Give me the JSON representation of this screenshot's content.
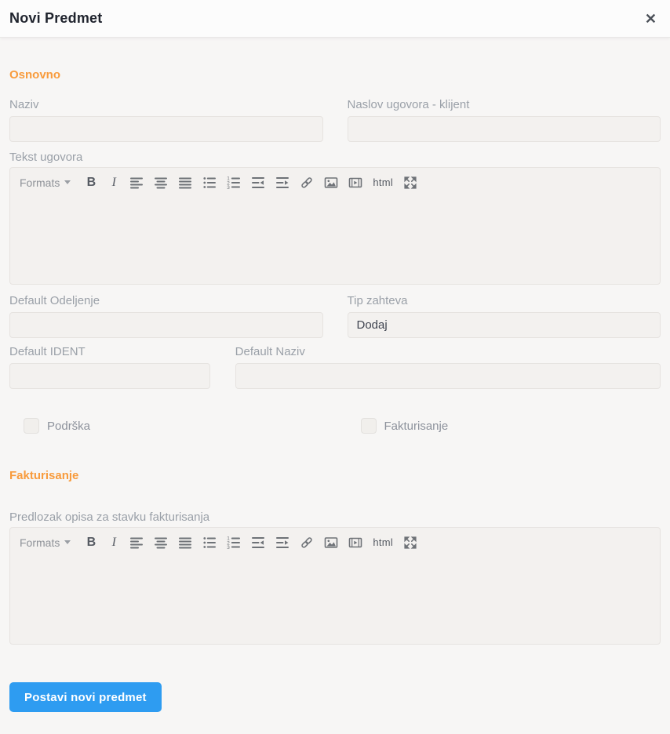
{
  "modal": {
    "title": "Novi Predmet",
    "close_glyph": "✕"
  },
  "sections": [
    {
      "heading": "Osnovno"
    },
    {
      "heading": "Fakturisanje"
    }
  ],
  "fields": {
    "naziv": {
      "label": "Naziv",
      "value": ""
    },
    "naslov_ugovora_klijent": {
      "label": "Naslov ugovora - klijent",
      "value": ""
    },
    "tekst_ugovora": {
      "label": "Tekst ugovora",
      "content": ""
    },
    "default_odeljenje": {
      "label": "Default Odeljenje",
      "value": ""
    },
    "tip_zahteva": {
      "label": "Tip zahteva",
      "value": "Dodaj"
    },
    "default_ident": {
      "label": "Default IDENT",
      "value": ""
    },
    "default_naziv": {
      "label": "Default Naziv",
      "value": ""
    },
    "podrska": {
      "label": "Podrška",
      "checked": false
    },
    "fakturisanje": {
      "label": "Fakturisanje",
      "checked": false
    },
    "predlozak_opisa": {
      "label": "Predlozak opisa za stavku fakturisanja",
      "content": ""
    }
  },
  "editor_toolbar": {
    "formats_label": "Formats",
    "bold_glyph": "B",
    "italic_glyph": "I",
    "html_label": "html",
    "buttons": [
      "formats",
      "bold",
      "italic",
      "align-left",
      "align-center",
      "align-justify",
      "bullet-list",
      "numbered-list",
      "outdent",
      "indent",
      "link",
      "image",
      "media",
      "html",
      "fullscreen"
    ]
  },
  "actions": {
    "submit_label": "Postavi novi predmet"
  },
  "colors": {
    "accent_orange": "#f89b3c",
    "primary_blue": "#2e9cf1",
    "label_gray": "#9aa0a8",
    "field_bg": "#f3f1ef",
    "field_border": "#e6e3e0"
  }
}
